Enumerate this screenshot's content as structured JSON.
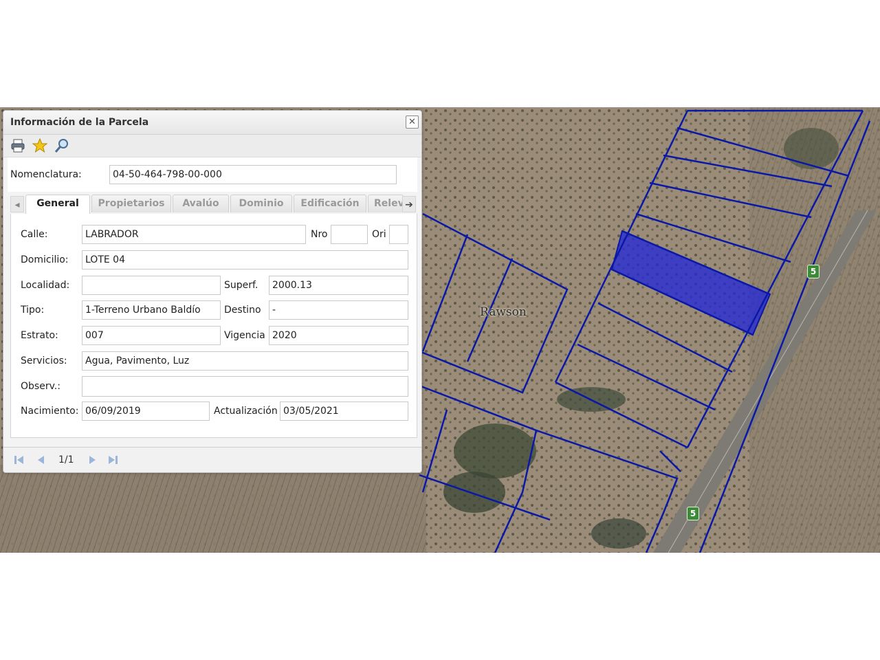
{
  "map": {
    "place_label": "Rawson",
    "route_badges": [
      "5",
      "5"
    ],
    "colors": {
      "parcel_line": "#0a18a8",
      "selected_fill": "#2328d6",
      "road": "#7d7b74",
      "terrain": "#8a7d6c"
    }
  },
  "panel": {
    "title": "Información de la Parcela",
    "close_glyph": "✕",
    "toolbar_icons": [
      "print-icon",
      "star-icon",
      "zoom-icon"
    ],
    "nomenclatura_label": "Nomenclatura:",
    "nomenclatura_value": "04-50-464-798-00-000",
    "tabs": [
      "General",
      "Propietarios",
      "Avalúo",
      "Dominio",
      "Edificación",
      "Relev"
    ],
    "active_tab": "General",
    "fields": {
      "calle_label": "Calle:",
      "calle_value": "LABRADOR",
      "nro_label": "Nro",
      "nro_value": "",
      "ori_label": "Ori",
      "ori_value": "",
      "domicilio_label": "Domicilio:",
      "domicilio_value": "LOTE 04",
      "localidad_label": "Localidad:",
      "localidad_value": "",
      "superf_label": "Superf.",
      "superf_value": "2000.13",
      "tipo_label": "Tipo:",
      "tipo_value": "1-Terreno Urbano Baldío",
      "destino_label": "Destino",
      "destino_value": "-",
      "estrato_label": "Estrato:",
      "estrato_value": "007",
      "vigencia_label": "Vigencia",
      "vigencia_value": "2020",
      "servicios_label": "Servicios:",
      "servicios_value": "Agua, Pavimento, Luz",
      "observ_label": "Observ.:",
      "observ_value": "",
      "nacimiento_label": "Nacimiento:",
      "nacimiento_value": "06/09/2019",
      "actualizacion_label": "Actualización",
      "actualizacion_value": "03/05/2021"
    },
    "pager": {
      "text": "1/1"
    }
  }
}
